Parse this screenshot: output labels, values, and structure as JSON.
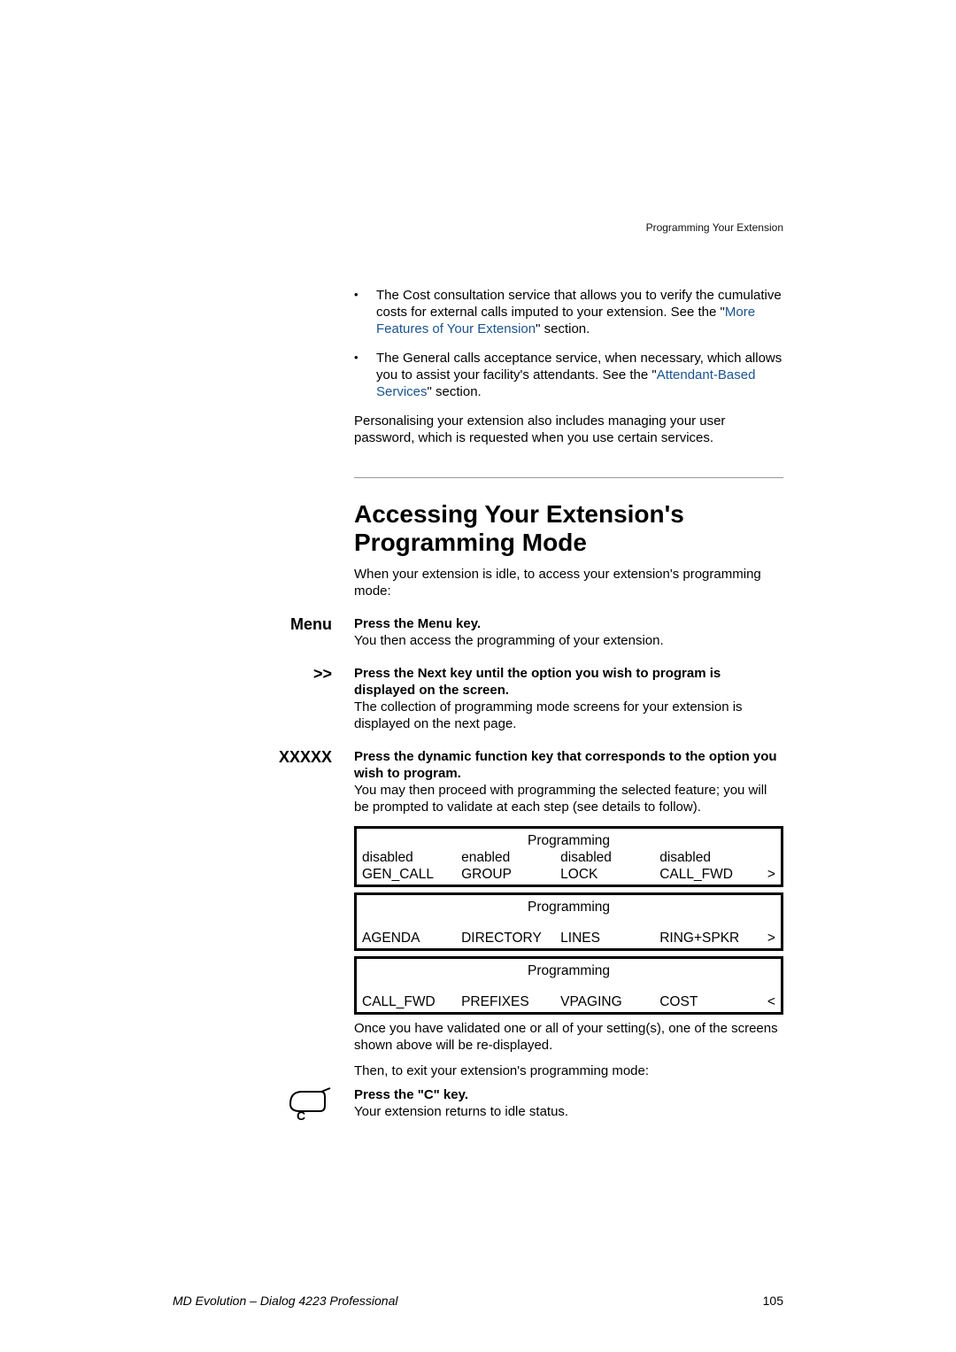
{
  "header": {
    "tag": "Programming Your Extension"
  },
  "bullets": [
    {
      "pre": "The Cost consultation service that allows you to verify the cumulative costs for external calls imputed to your extension. See the \"",
      "link": "More Features of Your Extension",
      "post": "\" section."
    },
    {
      "pre": "The General calls acceptance service, when necessary, which allows you to assist your facility's attendants. See the \"",
      "link": "Attendant-Based Services",
      "post": "\" section."
    }
  ],
  "intro_para": "Personalising your extension also includes managing your user password, which is requested when you use certain services.",
  "section_heading": "Accessing Your Extension's Programming Mode",
  "section_intro": "When your extension is idle, to access your extension's programming mode:",
  "steps": {
    "menu": {
      "label": "Menu",
      "bold": "Press the Menu key.",
      "text": "You then access the programming of your extension."
    },
    "next": {
      "label": ">>",
      "bold": "Press the Next key until the option you wish to program is displayed on the screen.",
      "text": "The collection of programming mode screens for your extension is displayed on the next page."
    },
    "dyn": {
      "label": "XXXXX",
      "bold": "Press the dynamic function key that corresponds to the option you wish to program.",
      "text": "You may then proceed with programming the selected feature; you will be prompted to validate at each step (see details to follow)."
    }
  },
  "screens": [
    {
      "title": "Programming",
      "row1": [
        "disabled",
        "enabled",
        "disabled",
        "disabled"
      ],
      "row2": [
        "GEN_CALL",
        "GROUP",
        "LOCK",
        "CALL_FWD"
      ],
      "arrow": ">"
    },
    {
      "title": "Programming",
      "row1": [
        "",
        "",
        "",
        ""
      ],
      "row2": [
        "AGENDA",
        "DIRECTORY",
        "LINES",
        "RING+SPKR"
      ],
      "arrow": ">"
    },
    {
      "title": "Programming",
      "row1": [
        "",
        "",
        "",
        ""
      ],
      "row2": [
        "CALL_FWD",
        "PREFIXES",
        "VPAGING",
        "COST"
      ],
      "arrow": "<"
    }
  ],
  "after_screens": "Once you have validated one or all of your setting(s), one of the screens shown above will be re-displayed.",
  "exit_intro": "Then, to exit your extension's programming mode:",
  "ckey": {
    "bold": "Press the \"C\" key.",
    "text": "Your extension returns to idle status."
  },
  "footer": {
    "left": "MD Evolution – Dialog 4223 Professional",
    "right": "105"
  }
}
